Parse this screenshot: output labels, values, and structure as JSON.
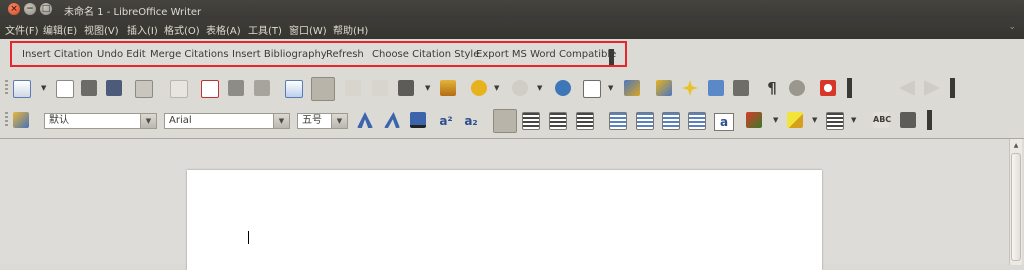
{
  "window": {
    "title": "未命名 1 - LibreOffice Writer",
    "controls": {
      "close": "×",
      "minimize": "−",
      "maximize": "□"
    }
  },
  "menubar": {
    "items": [
      {
        "label": "文件(F)"
      },
      {
        "label": "编辑(E)"
      },
      {
        "label": "视图(V)"
      },
      {
        "label": "插入(I)"
      },
      {
        "label": "格式(O)"
      },
      {
        "label": "表格(A)"
      },
      {
        "label": "工具(T)"
      },
      {
        "label": "窗口(W)"
      },
      {
        "label": "帮助(H)"
      }
    ],
    "overflow_icon": "chevron-down-icon"
  },
  "extension_toolbar": {
    "buttons": [
      {
        "label": "Insert Citation"
      },
      {
        "label": "Undo Edit"
      },
      {
        "label": "Merge Citations"
      },
      {
        "label": "Insert Bibliography"
      },
      {
        "label": "Refresh"
      },
      {
        "label": "Choose Citation Style"
      },
      {
        "label": "Export MS Word Compatible"
      }
    ],
    "highlight_color": "#e8262a"
  },
  "standard_toolbar": {
    "icons": [
      "new-document-icon",
      "open-folder-icon",
      "save-icon",
      "email-icon",
      "edit-file-icon",
      "export-pdf-icon",
      "print-icon",
      "print-preview-icon",
      "spellcheck-icon",
      "autospellcheck-icon",
      "cut-icon",
      "copy-icon",
      "paste-icon",
      "clone-formatting-icon",
      "undo-icon",
      "redo-icon",
      "hyperlink-icon",
      "table-icon",
      "show-draw-functions-icon",
      "find-replace-icon",
      "navigator-icon",
      "gallery-icon",
      "data-sources-icon",
      "formatting-marks-icon",
      "zoom-icon",
      "help-icon",
      "back-icon",
      "forward-icon"
    ]
  },
  "formatting_toolbar": {
    "style_value": "默认",
    "font_value": "Arial",
    "size_value": "五号",
    "text_buttons": {
      "superscript": "a²",
      "subscript": "a₂",
      "fontwork": "a"
    },
    "format_icons": [
      "bold-icon",
      "italic-icon",
      "underline-icon"
    ],
    "align_icons": [
      "align-left-icon",
      "align-center-icon",
      "align-right-icon",
      "justify-icon"
    ],
    "list_icons": [
      "numbering-icon",
      "bullets-icon",
      "decrease-indent-icon",
      "increase-indent-icon"
    ]
  },
  "colors": {
    "accent": "#e8262a",
    "titlebar": "#3c3b37"
  }
}
